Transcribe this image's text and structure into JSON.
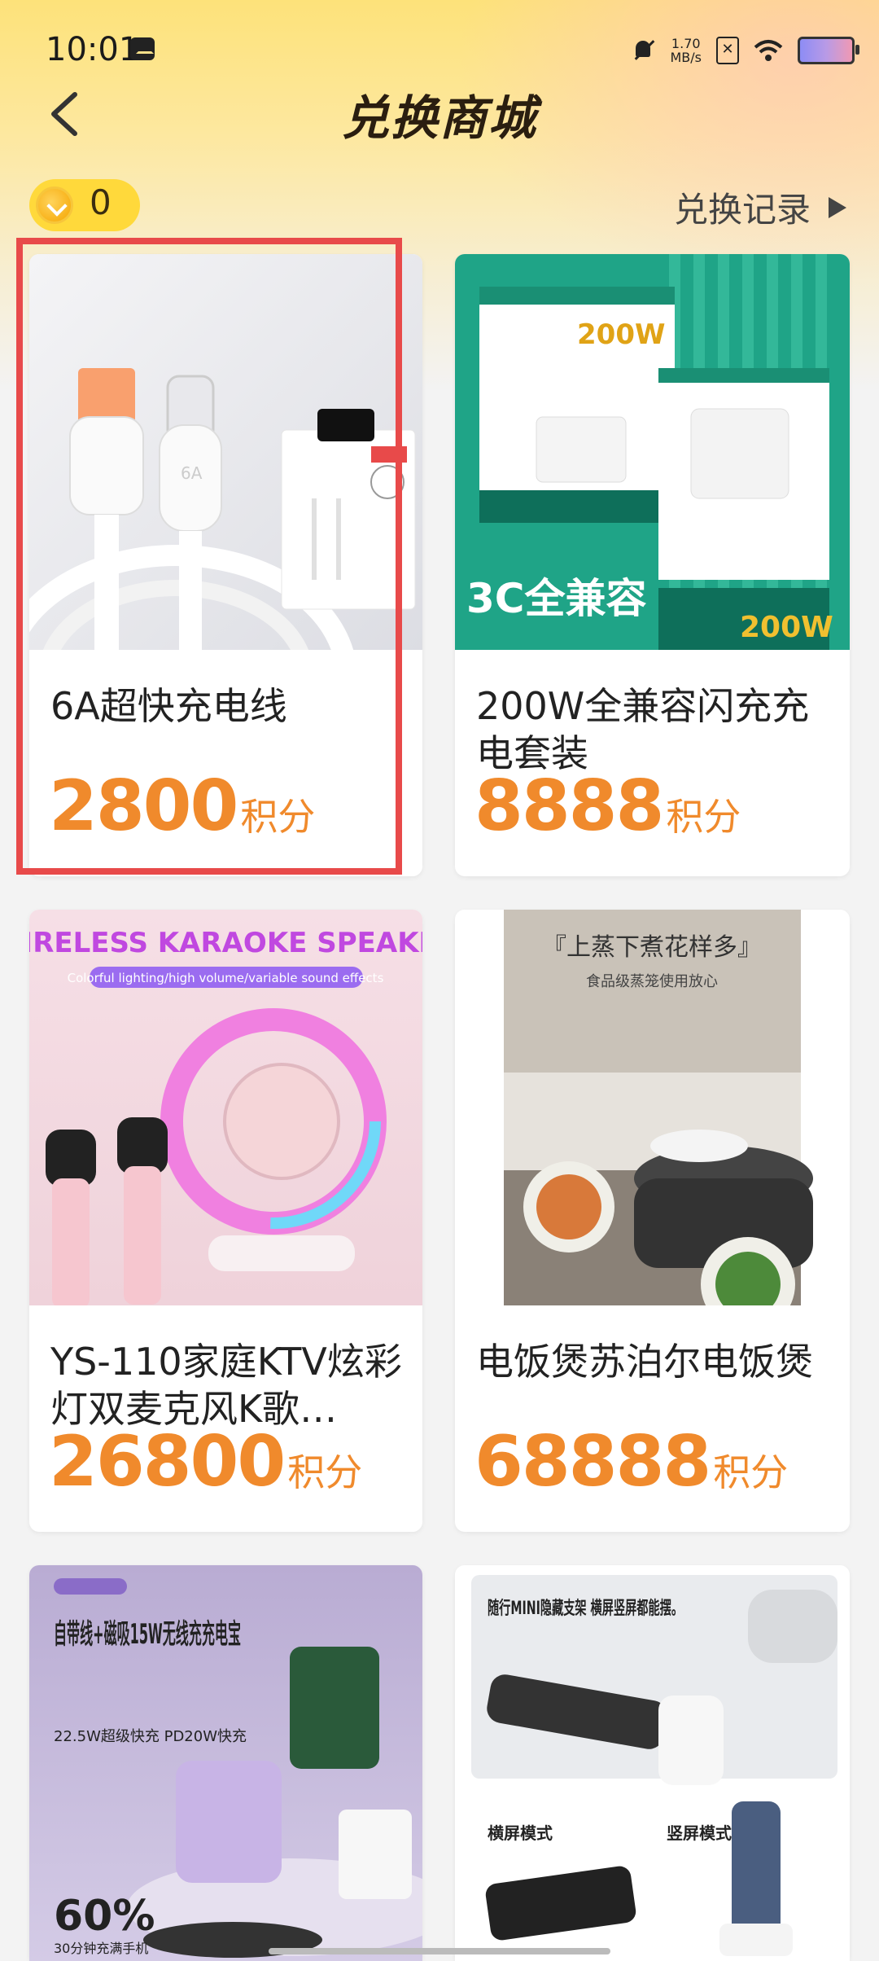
{
  "status_bar": {
    "time": "10:01",
    "net_speed_value": "1.70",
    "net_speed_unit": "MB/s"
  },
  "header": {
    "title": "兑换商城"
  },
  "points": {
    "balance": "0"
  },
  "records_link": {
    "label": "兑换记录"
  },
  "products": [
    {
      "name": "6A超快充电线",
      "price": "2800",
      "unit": "积分",
      "image_text": "6A",
      "selected": true
    },
    {
      "name": "200W全兼容闪充充电套装",
      "price": "8888",
      "unit": "积分",
      "image_text": "3C全兼容",
      "image_badge": "200W"
    },
    {
      "name": "YS-110家庭KTV炫彩灯双麦克风K歌…",
      "price": "26800",
      "unit": "积分",
      "image_text": "WIRELESS KARAOKE SPEAKER",
      "image_subtext": "Colorful lighting/high volume/variable sound effects"
    },
    {
      "name": "电饭煲苏泊尔电饭煲",
      "price": "68888",
      "unit": "积分",
      "image_text": "『上蒸下煮花样多』",
      "image_subtext": "食品级蒸笼使用放心"
    },
    {
      "name": "自带线+磁吸15W无线充充电宝",
      "image_text": "自带线+磁吸15W无线充充电宝",
      "image_subtext": "22.5W超级快充 PD20W快充",
      "image_percent": "60%",
      "image_caption": "30分钟充满手机"
    },
    {
      "name": "随行MINI隐藏支架",
      "image_text": "随行MINI隐藏支架 横屏竖屏都能摆。",
      "image_label_1": "横屏模式",
      "image_label_2": "竖屏模式"
    }
  ],
  "colors": {
    "accent": "#f08a2c",
    "highlight": "#e84a4a",
    "coin": "#ffd93b"
  }
}
